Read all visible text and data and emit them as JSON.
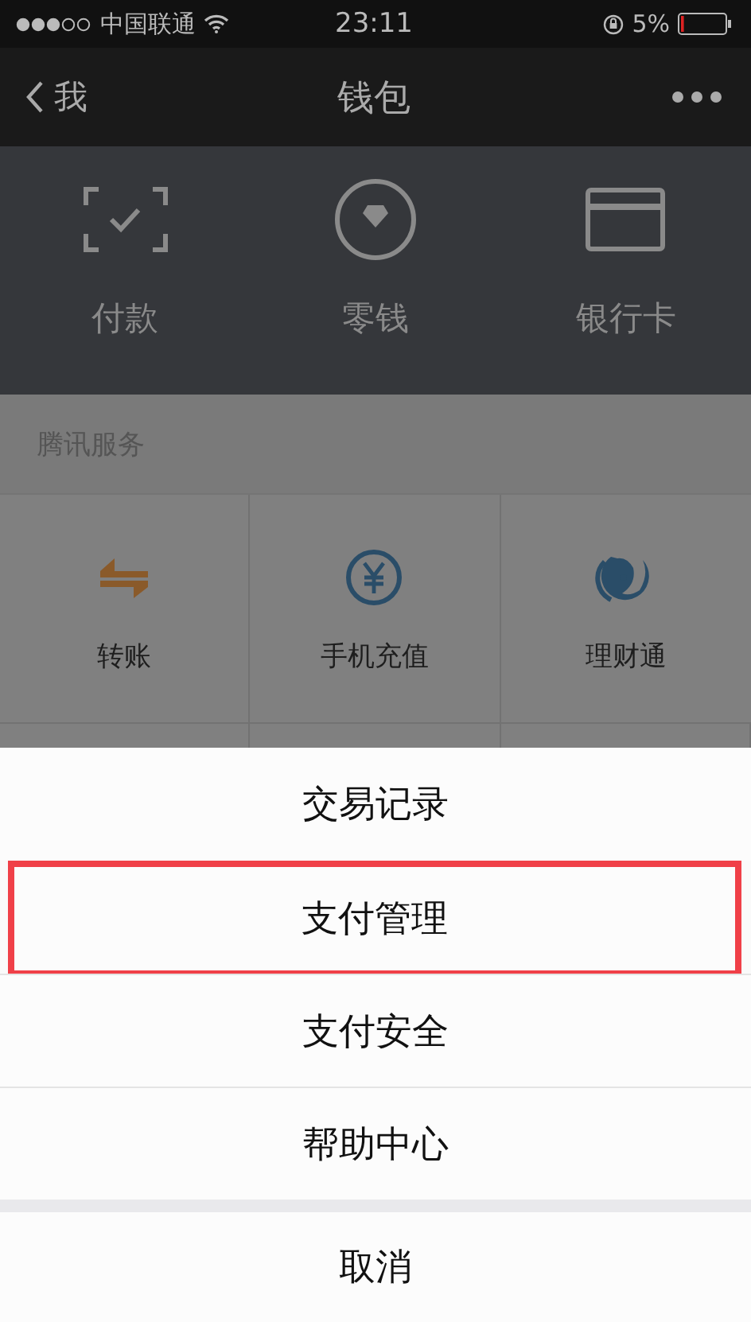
{
  "status_bar": {
    "carrier": "中国联通",
    "time": "23:11",
    "battery": "5%"
  },
  "nav_bar": {
    "back_label": "我",
    "title": "钱包"
  },
  "wallet_items": [
    {
      "label": "付款",
      "kind": "scan"
    },
    {
      "label": "零钱",
      "kind": "coin"
    },
    {
      "label": "银行卡",
      "kind": "card"
    }
  ],
  "section_title": "腾讯服务",
  "services": [
    {
      "label": "转账",
      "kind": "transfer"
    },
    {
      "label": "手机充值",
      "kind": "yuan"
    },
    {
      "label": "理财通",
      "kind": "fish"
    }
  ],
  "action_sheet": {
    "items": [
      {
        "label": "交易记录",
        "highlighted": false
      },
      {
        "label": "支付管理",
        "highlighted": true
      },
      {
        "label": "支付安全",
        "highlighted": false
      },
      {
        "label": "帮助中心",
        "highlighted": false
      }
    ],
    "cancel": "取消"
  }
}
